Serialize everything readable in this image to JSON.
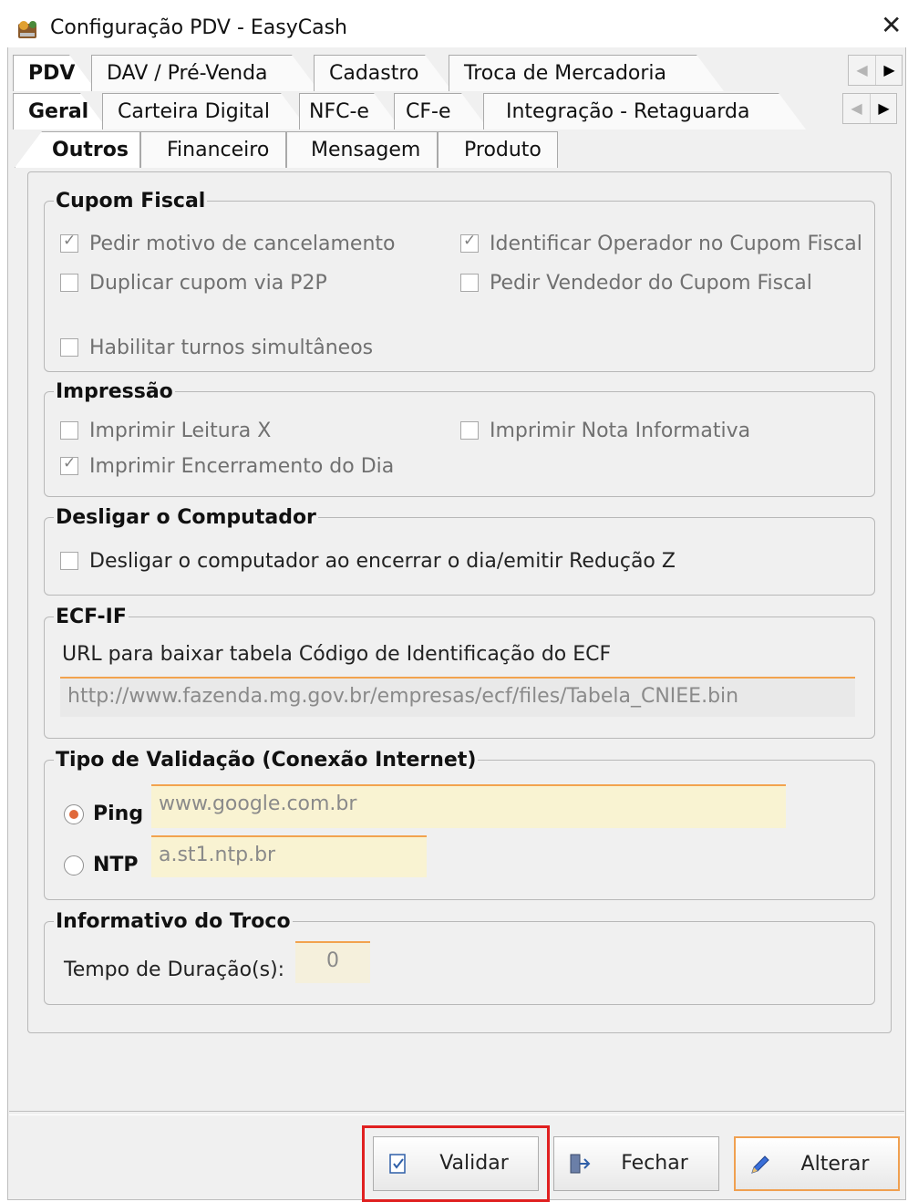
{
  "window": {
    "title": "Configuração PDV - EasyCash"
  },
  "tabs_row1": [
    "PDV",
    "DAV / Pré-Venda",
    "Cadastro",
    "Troca de Mercadoria"
  ],
  "tabs_row2": [
    "Geral",
    "Carteira Digital",
    "NFC-e",
    "CF-e",
    "Integração - Retaguarda"
  ],
  "tabs_row3": [
    "Outros",
    "Financeiro",
    "Mensagem",
    "Produto"
  ],
  "cupom": {
    "legend": "Cupom Fiscal",
    "pedir_motivo": "Pedir motivo de cancelamento",
    "identificar_operador": "Identificar Operador no Cupom Fiscal",
    "duplicar": "Duplicar cupom via P2P",
    "pedir_vendedor": "Pedir Vendedor do Cupom Fiscal",
    "turnos": "Habilitar turnos simultâneos"
  },
  "impressao": {
    "legend": "Impressão",
    "leitura_x": "Imprimir Leitura X",
    "nota_informativa": "Imprimir Nota Informativa",
    "encerramento": "Imprimir Encerramento do Dia"
  },
  "desligar": {
    "legend": "Desligar o Computador",
    "label": "Desligar o computador ao encerrar o dia/emitir Redução Z"
  },
  "ecf": {
    "legend": "ECF-IF",
    "label": "URL para baixar tabela Código de Identificação do ECF",
    "url": "http://www.fazenda.mg.gov.br/empresas/ecf/files/Tabela_CNIEE.bin"
  },
  "validacao": {
    "legend": "Tipo de Validação (Conexão Internet)",
    "ping_label": "Ping",
    "ping_value": "www.google.com.br",
    "ntp_label": "NTP",
    "ntp_value": "a.st1.ntp.br"
  },
  "troco": {
    "legend": "Informativo do Troco",
    "label": "Tempo de Duração(s):",
    "value": "0"
  },
  "buttons": {
    "validar": "Validar",
    "fechar": "Fechar",
    "alterar": "Alterar"
  }
}
